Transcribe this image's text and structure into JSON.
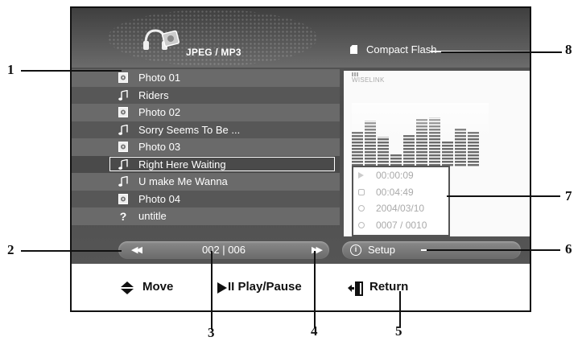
{
  "header": {
    "title": "JPEG / MP3",
    "storage_label": "Compact Flash"
  },
  "file_list": [
    {
      "type": "photo",
      "label": "Photo 01",
      "selected": false
    },
    {
      "type": "music",
      "label": "Riders",
      "selected": false
    },
    {
      "type": "photo",
      "label": "Photo 02",
      "selected": false
    },
    {
      "type": "music",
      "label": "Sorry Seems To Be ...",
      "selected": false
    },
    {
      "type": "photo",
      "label": "Photo 03",
      "selected": false
    },
    {
      "type": "music",
      "label": "Right Here Waiting",
      "selected": true
    },
    {
      "type": "music",
      "label": "U make Me Wanna",
      "selected": false
    },
    {
      "type": "photo",
      "label": "Photo 04",
      "selected": false
    },
    {
      "type": "unknown",
      "label": "untitle",
      "selected": false
    }
  ],
  "preview": {
    "brand": "WISELINK"
  },
  "info": {
    "elapsed": "00:00:09",
    "duration": "00:04:49",
    "date": "2004/03/10",
    "track": "0007 / 0010"
  },
  "pagination": {
    "text": "002 | 006"
  },
  "setup": {
    "label": "Setup"
  },
  "footer": {
    "move": "Move",
    "play_pause": "II Play/Pause",
    "return": "Return"
  },
  "callouts": [
    "1",
    "2",
    "3",
    "4",
    "5",
    "6",
    "7",
    "8"
  ],
  "colors": {
    "screen_bg": "#555555",
    "selection_border": "#ffffff",
    "callout_ink": "#111111"
  }
}
